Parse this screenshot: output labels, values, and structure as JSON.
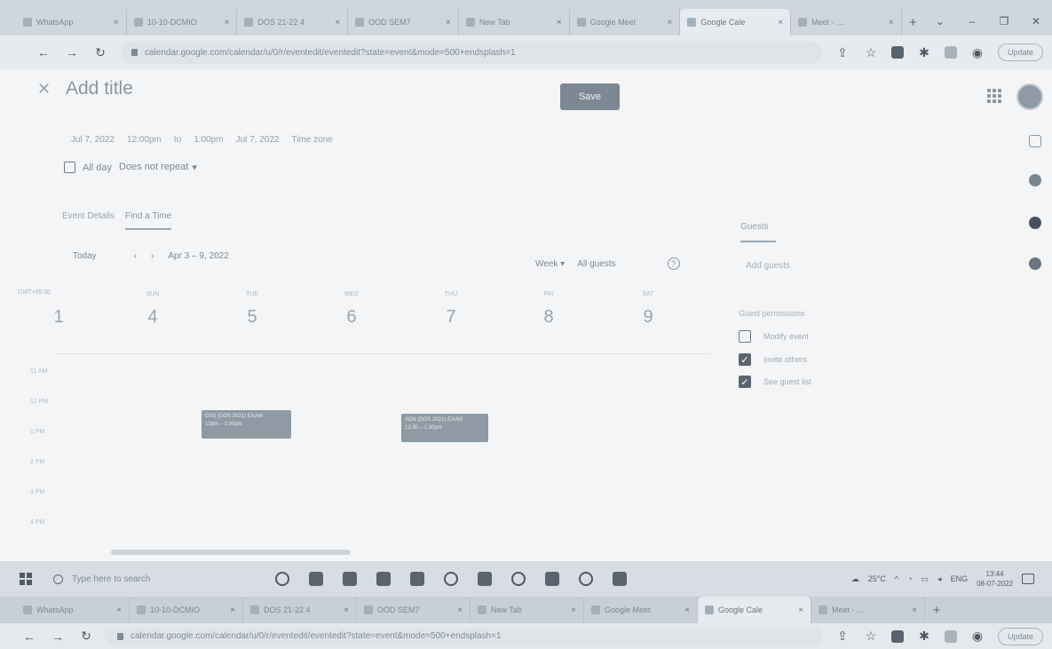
{
  "browser": {
    "tabs": [
      {
        "label": "WhatsApp"
      },
      {
        "label": "10-10-DCMIO"
      },
      {
        "label": "DOS 21-22 4"
      },
      {
        "label": "OOD SEM7"
      },
      {
        "label": "New Tab"
      },
      {
        "label": "Google Meet"
      },
      {
        "label": "Google Cale"
      },
      {
        "label": "Meet - …"
      }
    ],
    "new_tab": "+",
    "url": "calendar.google.com/calendar/u/0/r/eventedit/eventedit?state=event&mode=500+endsplash=1",
    "update_label": "Update"
  },
  "event": {
    "title_placeholder": "Add title",
    "save_label": "Save",
    "start_date": "Jul 7, 2022",
    "start_time": "12:00pm",
    "to": "to",
    "end_time": "1:00pm",
    "end_date": "Jul 7, 2022",
    "time_zone": "Time zone",
    "allday_label": "All day",
    "repeat_label": "Does not repeat",
    "repeat_arrow": "▾"
  },
  "tabs": {
    "event_details": "Event Details",
    "find_a_time": "Find a Time"
  },
  "finder": {
    "today": "Today",
    "prev": "‹",
    "next": "›",
    "date_range": "Apr 3 – 9, 2022",
    "view": "Week",
    "view_arrow": "▾",
    "guests_filter": "All guests",
    "help": "?",
    "gmt": "GMT+05:30",
    "days": [
      {
        "name": "SUN",
        "num": "4"
      },
      {
        "name": "TUE",
        "num": "5"
      },
      {
        "name": "WED",
        "num": "6"
      },
      {
        "name": "THU",
        "num": "7"
      },
      {
        "name": "FRI",
        "num": "8"
      },
      {
        "name": "SAT",
        "num": "9"
      }
    ],
    "first_day_num": "1",
    "times": [
      "11 AM",
      "12 PM",
      "1 PM",
      "2 PM",
      "3 PM",
      "4 PM"
    ],
    "events": [
      {
        "title": "DSS (DOS 2021) EXAM",
        "time": "12pm – 1:30pm"
      },
      {
        "title": "ADN (DOS 2021) EXAM",
        "time": "12:30 – 1:30pm"
      }
    ]
  },
  "guests": {
    "tab_label": "Guests",
    "add_placeholder": "Add guests",
    "permissions_title": "Guest permissions",
    "permissions": [
      {
        "label": "Modify event",
        "checked": false
      },
      {
        "label": "Invite others",
        "checked": true
      },
      {
        "label": "See guest list",
        "checked": true
      }
    ]
  },
  "taskbar": {
    "search_placeholder": "Type here to search",
    "temperature": "25°C",
    "language": "ENG",
    "time": "13:44",
    "date": "08-07-2022"
  }
}
